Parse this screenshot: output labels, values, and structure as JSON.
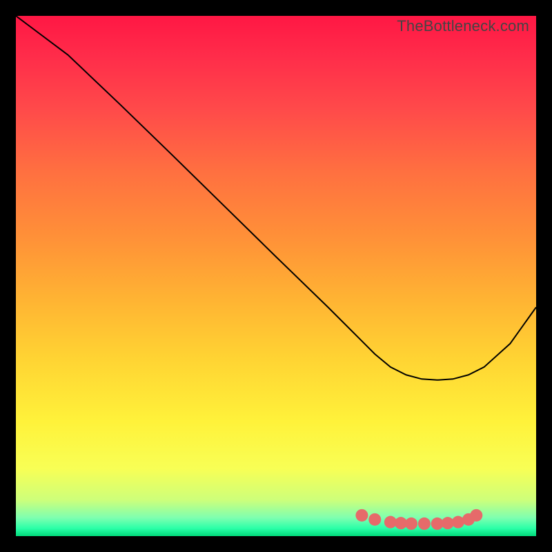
{
  "watermark": "TheBottleneck.com",
  "chart_data": {
    "type": "line",
    "title": "",
    "xlabel": "",
    "ylabel": "",
    "xlim": [
      0,
      100
    ],
    "ylim": [
      0,
      100
    ],
    "grid": false,
    "series": [
      {
        "name": "bottleneck-curve",
        "x": [
          0,
          4,
          10,
          20,
          30,
          40,
          50,
          60,
          66,
          69,
          72,
          75,
          78,
          81,
          84,
          87,
          90,
          95,
          100
        ],
        "y": [
          100,
          97,
          92.5,
          83,
          73.3,
          63.5,
          53.7,
          44,
          38,
          35,
          32.5,
          31,
          30.2,
          30,
          30.2,
          31,
          32.5,
          37,
          44
        ],
        "stroke": "#000000",
        "stroke_width": 2
      }
    ],
    "markers": {
      "name": "optimal-range-markers",
      "x": [
        66.5,
        69,
        72,
        74,
        76,
        78.5,
        81,
        83,
        85,
        87,
        88.5
      ],
      "y": [
        4,
        3.2,
        2.7,
        2.5,
        2.4,
        2.4,
        2.4,
        2.5,
        2.7,
        3.2,
        4
      ],
      "color": "#e66a6a",
      "size": 9
    },
    "gradient_background": {
      "type": "vertical",
      "stops": [
        {
          "pos": 0.0,
          "color": "#ff1744"
        },
        {
          "pos": 0.08,
          "color": "#ff2d4a"
        },
        {
          "pos": 0.18,
          "color": "#ff4a4a"
        },
        {
          "pos": 0.3,
          "color": "#ff7040"
        },
        {
          "pos": 0.42,
          "color": "#ff8f38"
        },
        {
          "pos": 0.54,
          "color": "#ffb233"
        },
        {
          "pos": 0.66,
          "color": "#ffd433"
        },
        {
          "pos": 0.78,
          "color": "#fff23a"
        },
        {
          "pos": 0.87,
          "color": "#f8ff55"
        },
        {
          "pos": 0.93,
          "color": "#ceff7a"
        },
        {
          "pos": 0.965,
          "color": "#7dffb0"
        },
        {
          "pos": 0.985,
          "color": "#2bffa8"
        },
        {
          "pos": 1.0,
          "color": "#00d97a"
        }
      ]
    }
  }
}
